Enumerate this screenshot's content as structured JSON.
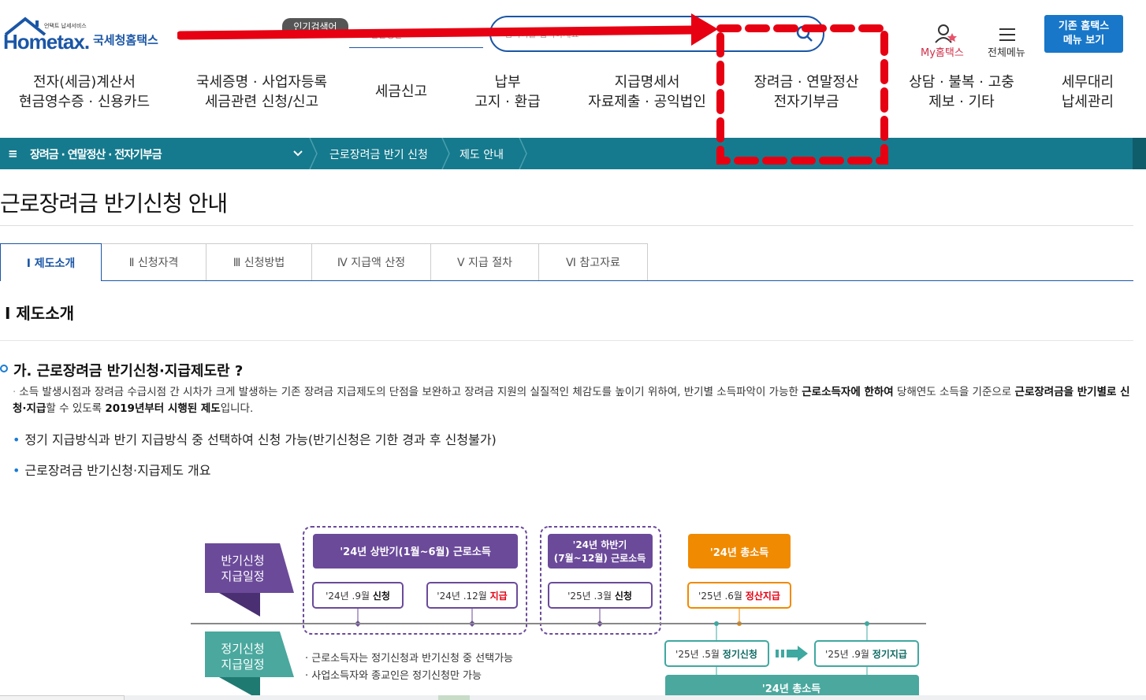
{
  "header": {
    "logo_tagline": "언택트 납세서비스",
    "logo_text": "Hometax.",
    "logo_kr": "국세청홈택스",
    "popular_badge": "인기검색어",
    "popular_text": "연말정산",
    "search_placeholder": "검색어를 입력하세요",
    "my_label": "My홈택스",
    "all_menu_label": "전체메뉴",
    "old_menu_line1": "기존 홈택스",
    "old_menu_line2": "메뉴 보기"
  },
  "gnb": [
    {
      "line1": "전자(세금)계산서",
      "line2": "현금영수증 · 신용카드"
    },
    {
      "line1": "국세증명 · 사업자등록",
      "line2": "세금관련 신청/신고"
    },
    {
      "line1": "세금신고",
      "line2": ""
    },
    {
      "line1": "납부",
      "line2": "고지 · 환급"
    },
    {
      "line1": "지급명세서",
      "line2": "자료제출 · 공익법인"
    },
    {
      "line1": "장려금 · 연말정산",
      "line2": "전자기부금"
    },
    {
      "line1": "상담 · 불복 · 고충",
      "line2": "제보 · 기타"
    },
    {
      "line1": "세무대리",
      "line2": "납세관리"
    }
  ],
  "breadcrumb": {
    "menu_icon": "≡",
    "item1": "장려금 · 연말정산 · 전자기부금",
    "item2": "근로장려금 반기 신청",
    "item3": "제도 안내"
  },
  "page_title": "근로장려금 반기신청 안내",
  "tabs": [
    {
      "label": "Ⅰ  제도소개"
    },
    {
      "label": "Ⅱ  신청자격"
    },
    {
      "label": "Ⅲ  신청방법"
    },
    {
      "label": "Ⅳ  지급액 산정"
    },
    {
      "label": "Ⅴ  지급 절차"
    },
    {
      "label": "Ⅵ  참고자료"
    }
  ],
  "section_title": "Ⅰ 제도소개",
  "sub_title": "가. 근로장려금 반기신청·지급제도란 ?",
  "paragraph": {
    "p1": "소득 발생시점과 장려금 수급시점 간 시차가 크게 발생하는 기존 장려금 지급제도의 단점을 보완하고 장려금 지원의 실질적인 체감도를 높이기 위하여, 반기별 소득파악이 가능한 ",
    "b1": "근로소득자에 한하여",
    "p2": " 당해연도 소득을 기준으로 ",
    "b2": "근로장려금을 반기별로 신청·지급",
    "p3": "할 수 있도록 ",
    "b3": "2019년부터 시행된 제도",
    "p4": "입니다."
  },
  "bullets": [
    "정기 지급방식과 반기 지급방식 중 선택하여 신청 가능(반기신청은 기한 경과 후 신청불가)",
    "근로장려금 반기신청·지급제도 개요"
  ],
  "diagram": {
    "half_label_1": "반기신청",
    "half_label_2": "지급일정",
    "regular_label_1": "정기신청",
    "regular_label_2": "지급일정",
    "h1_title": "'24년 상반기(1월~6월) 근로소득",
    "h1_apply_pre": "'24년 .9월 ",
    "h1_apply_bold": "신청",
    "h1_pay_pre": "'24년 .12월 ",
    "h1_pay_bold": "지급",
    "h2_title_1": "'24년 하반기",
    "h2_title_2": "(7월~12월) 근로소득",
    "h2_apply_pre": "'25년 .3월 ",
    "h2_apply_bold": "신청",
    "total_title": "'24년 총소득",
    "settle_pre": "'25년 .6월 ",
    "settle_bold": "정산지급",
    "reg_apply_pre": "'25년 .5월 ",
    "reg_apply_bold": "정기신청",
    "reg_pay_pre": "'25년 .9월 ",
    "reg_pay_bold": "정기지급",
    "reg_total": "'24년 총소득",
    "note1": "· 근로소득자는 정기신청과 반기신청 중 선택가능",
    "note2": "· 사업소득자와 종교인은 정기신청만 가능"
  },
  "colors": {
    "brand_blue": "#1a56a6",
    "teal_bar": "#157a8d",
    "purple": "#6b4a9a",
    "orange": "#f08a00",
    "teal_box": "#3fa8a0",
    "annotation_red": "#e60012"
  }
}
